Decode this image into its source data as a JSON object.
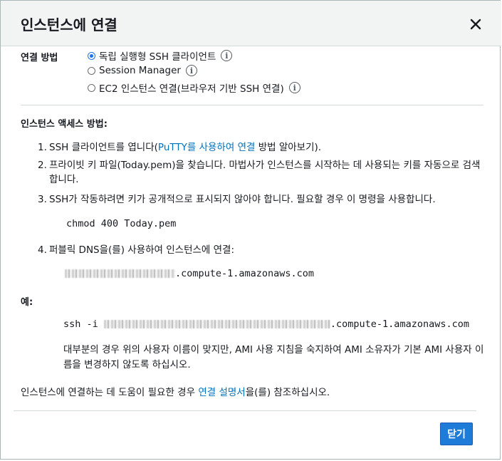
{
  "dialog": {
    "title": "인스턴스에 연결",
    "close_label": "Close"
  },
  "connection_method": {
    "label": "연결 방법",
    "options": [
      {
        "label": "독립 실행형 SSH 클라이언트",
        "selected": true
      },
      {
        "label": "Session Manager",
        "selected": false
      },
      {
        "label": "EC2 인스턴스 연결(브라우저 기반 SSH 연결)",
        "selected": false
      }
    ],
    "info_glyph": "i"
  },
  "instructions": {
    "title": "인스턴스 액세스 방법:",
    "step1_num": "1.",
    "step1_pre": "SSH 클라이언트를 엽니다(",
    "step1_link": "PuTTY를 사용하여 연결",
    "step1_post": " 방법 알아보기).",
    "step2_num": "2.",
    "step2_text": "프라이빗 키 파일(Today.pem)을 찾습니다. 마법사가 인스턴스를 시작하는 데 사용되는 키를 자동으로 검색합니다.",
    "step3_num": "3.",
    "step3_text": "SSH가 작동하려면 키가 공개적으로 표시되지 않아야 합니다. 필요할 경우 이 명령을 사용합니다.",
    "chmod_command": "chmod 400 Today.pem",
    "step4_num": "4.",
    "step4_text": "퍼블릭 DNS을(를) 사용하여 인스턴스에 연결:",
    "dns_suffix": ".compute-1.amazonaws.com"
  },
  "example": {
    "label": "예:",
    "ssh_prefix": "ssh -i ",
    "ssh_suffix": ".compute-1.amazonaws.com",
    "note": "대부분의 경우 위의 사용자 이름이 맞지만, AMI 사용 지침을 숙지하여 AMI 소유자가 기본 AMI 사용자 이름을 변경하지 않도록 하십시오."
  },
  "help": {
    "pre": "인스턴스에 연결하는 데 도움이 필요한 경우 ",
    "link": "연결 설명서",
    "post": "을(를) 참조하십시오."
  },
  "footer": {
    "close_button": "닫기",
    "accent_color": "#1f7bd8"
  }
}
